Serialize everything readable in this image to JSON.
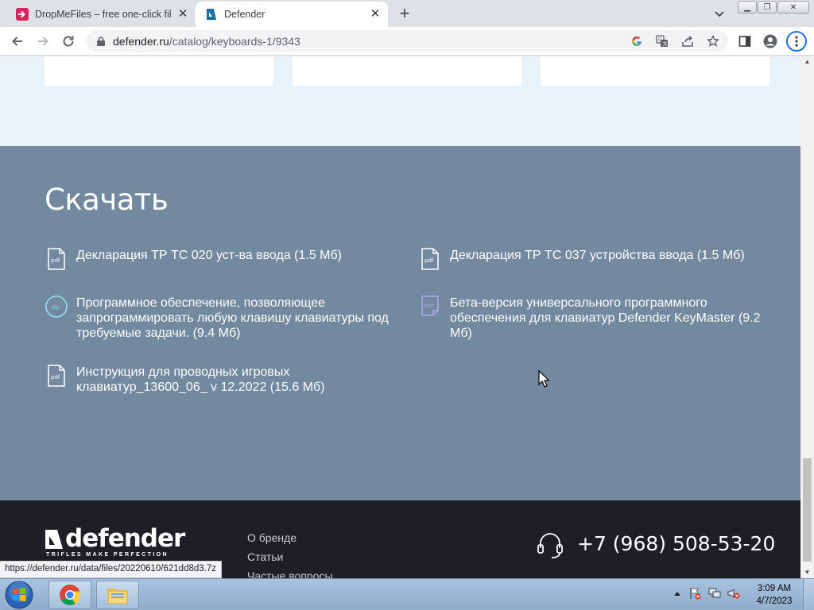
{
  "browser": {
    "tabs": [
      {
        "title": "DropMeFiles – free one-click file"
      },
      {
        "title": "Defender"
      }
    ],
    "address": {
      "domain": "defender.ru",
      "path": "/catalog/keyboards-1/9343"
    }
  },
  "page": {
    "download": {
      "title": "Скачать",
      "items": [
        {
          "icon": "pdf",
          "text": "Декларация ТР ТС 020 уст-ва ввода (1.5 Мб)"
        },
        {
          "icon": "pdf",
          "text": "Декларация ТР ТС 037 устройства ввода (1.5 Мб)"
        },
        {
          "icon": "zip",
          "text": "Программное обеспечение, позволяющее запрограммировать любую клавишу клавиатуры под требуемые задачи. (9.4 Мб)"
        },
        {
          "icon": "exe",
          "text": "Бета-версия универсального программного обеспечения для клавиатур Defender KeyMaster (9.2 Мб)"
        },
        {
          "icon": "pdf",
          "text": "Инструкция для проводных игровых клавиатур_13600_06_ v 12.2022 (15.6 Мб)"
        }
      ]
    },
    "footer": {
      "logo_text": "defender",
      "logo_tagline": "TRIFLES MAKE PERFECTION",
      "links": [
        "О бренде",
        "Статьи",
        "Частые вопросы"
      ],
      "phone": "+7 (968) 508-53-20"
    }
  },
  "status_bar": {
    "url": "https://defender.ru/data/files/20220610/621dd8d3.7z"
  },
  "taskbar": {
    "time": "3:09 AM",
    "date": "4/7/2023"
  },
  "colors": {
    "section_bg": "#7289a0",
    "footer_bg": "#1e1f24",
    "page_bg": "#e8f3fc",
    "accent_zip": "#8fe0f0",
    "accent_exe": "#a9a7f0"
  }
}
